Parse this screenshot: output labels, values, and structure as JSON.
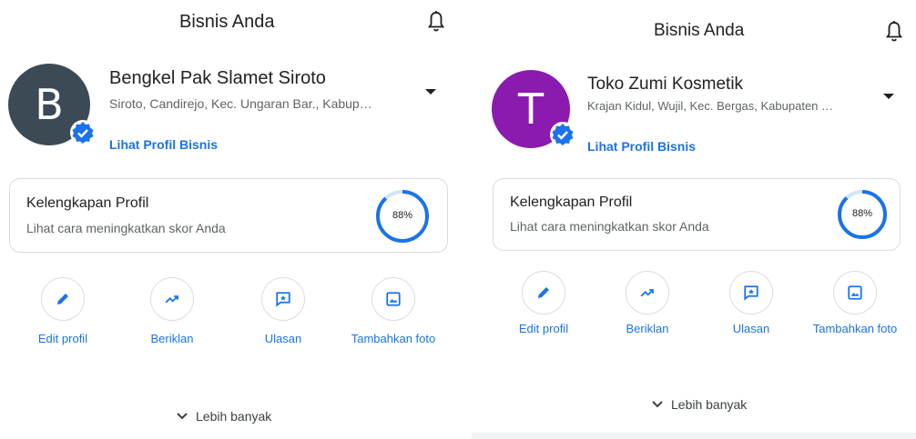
{
  "colors": {
    "accent": "#1a73e8",
    "avatar_b": "#3c4a55",
    "avatar_t": "#8b1aaf",
    "verified": "#1a73e8"
  },
  "panels": [
    {
      "header_title": "Bisnis Anda",
      "avatar_letter": "B",
      "business_name": "Bengkel Pak Slamet Siroto",
      "address": "Siroto, Candirejo, Kec. Ungaran Bar., Kabup…",
      "profile_link": "Lihat Profil Bisnis",
      "card": {
        "title": "Kelengkapan Profil",
        "subtitle": "Lihat cara meningkatkan skor Anda",
        "percent_label": "88%",
        "percent": 88
      },
      "actions": [
        {
          "label": "Edit profil",
          "icon": "pencil-icon"
        },
        {
          "label": "Beriklan",
          "icon": "trending-up-icon"
        },
        {
          "label": "Ulasan",
          "icon": "review-icon"
        },
        {
          "label": "Tambahkan foto",
          "icon": "photo-icon"
        }
      ],
      "more_label": "Lebih banyak"
    },
    {
      "header_title": "Bisnis Anda",
      "avatar_letter": "T",
      "business_name": "Toko Zumi Kosmetik",
      "address": "Krajan Kidul, Wujil, Kec. Bergas, Kabupaten …",
      "profile_link": "Lihat Profil Bisnis",
      "card": {
        "title": "Kelengkapan Profil",
        "subtitle": "Lihat cara meningkatkan skor Anda",
        "percent_label": "88%",
        "percent": 88
      },
      "actions": [
        {
          "label": "Edit profil",
          "icon": "pencil-icon"
        },
        {
          "label": "Beriklan",
          "icon": "trending-up-icon"
        },
        {
          "label": "Ulasan",
          "icon": "review-icon"
        },
        {
          "label": "Tambahkan foto",
          "icon": "photo-icon"
        }
      ],
      "more_label": "Lebih banyak"
    }
  ]
}
